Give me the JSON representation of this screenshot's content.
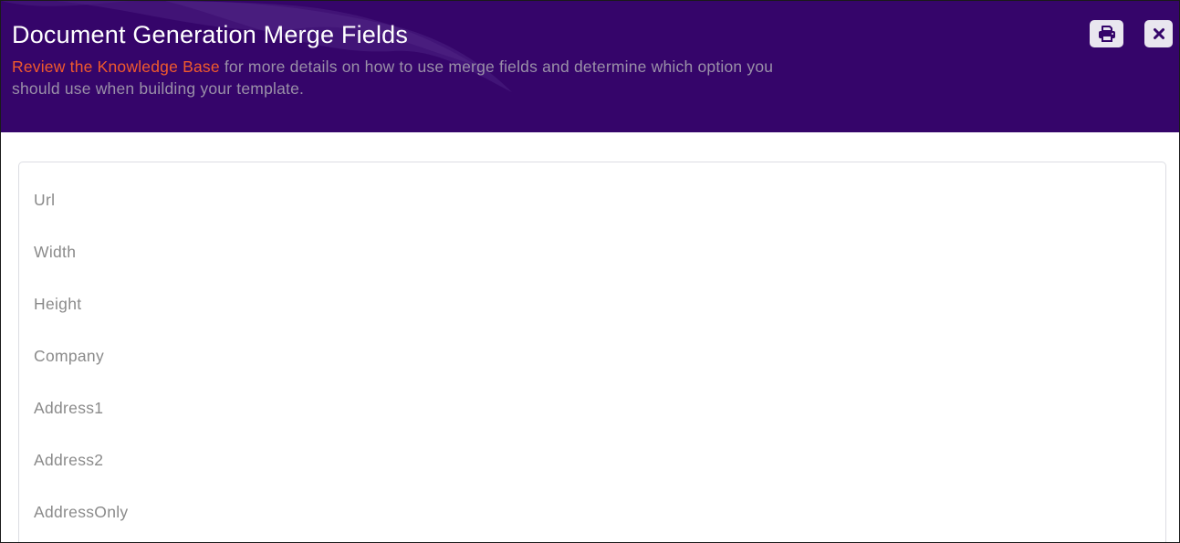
{
  "header": {
    "title": "Document Generation Merge Fields",
    "link_text": "Review the Knowledge Base",
    "description": " for more details on how to use merge fields and determine which option you should use when building your template.",
    "print_icon": "printer-icon",
    "close_icon": "close-icon"
  },
  "fields": [
    "Url",
    "Width",
    "Height",
    "Company",
    "Address1",
    "Address2",
    "AddressOnly"
  ],
  "colors": {
    "header_bg": "#35056a",
    "link": "#f15a2c",
    "title": "#ffffff",
    "description": "#9a90a8",
    "field_text": "#8a8a8a"
  }
}
